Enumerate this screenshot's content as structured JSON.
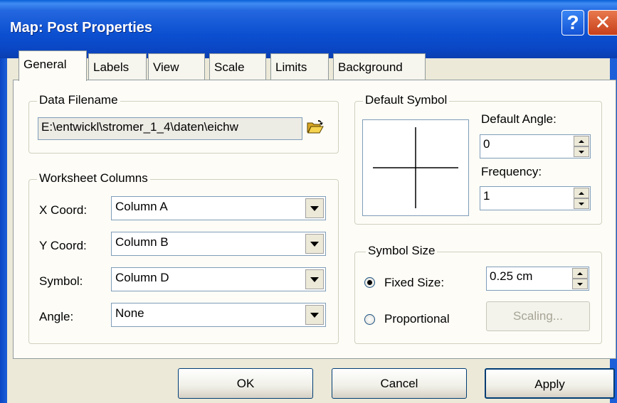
{
  "window": {
    "title": "Map: Post Properties"
  },
  "tabs": [
    {
      "label": "General"
    },
    {
      "label": "Labels"
    },
    {
      "label": "View"
    },
    {
      "label": "Scale"
    },
    {
      "label": "Limits"
    },
    {
      "label": "Background"
    }
  ],
  "data_filename": {
    "legend": "Data Filename",
    "value": "E:\\entwickl\\stromer_1_4\\daten\\eichw",
    "icon": "open-folder-icon"
  },
  "worksheet_columns": {
    "legend": "Worksheet Columns",
    "x_coord": {
      "label": "X Coord:",
      "value": "Column A"
    },
    "y_coord": {
      "label": "Y Coord:",
      "value": "Column B"
    },
    "symbol": {
      "label": "Symbol:",
      "value": "Column D"
    },
    "angle": {
      "label": "Angle:",
      "value": "None"
    }
  },
  "default_symbol": {
    "legend": "Default Symbol",
    "angle_label": "Default Angle:",
    "angle_value": "0",
    "frequency_label": "Frequency:",
    "frequency_value": "1"
  },
  "symbol_size": {
    "legend": "Symbol Size",
    "fixed_label": "Fixed Size:",
    "fixed_value": "0.25 cm",
    "proportional_label": "Proportional",
    "scaling_label": "Scaling...",
    "selected": "fixed"
  },
  "buttons": {
    "ok": "OK",
    "cancel": "Cancel",
    "apply": "Apply"
  },
  "colors": {
    "titlebar": "#0a46c4",
    "dialog_bg": "#ece9d8",
    "panel_bg": "#fdfcf7",
    "close": "#c7401b"
  }
}
